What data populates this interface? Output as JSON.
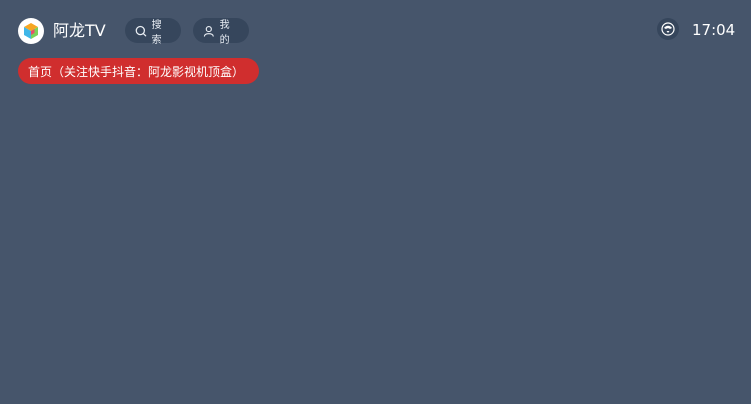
{
  "header": {
    "app_title": "阿龙TV",
    "logo_icon": "cube-logo-icon",
    "search_label": "搜索",
    "mine_label": "我的",
    "time": "17:04"
  },
  "tabs": [
    {
      "label": "首页（关注快手抖音：阿龙影视机顶盒）",
      "active": true
    }
  ],
  "colors": {
    "background": "#46556b",
    "pill": "#36465c",
    "active_tab": "#d02e2e",
    "text": "#ffffff"
  }
}
